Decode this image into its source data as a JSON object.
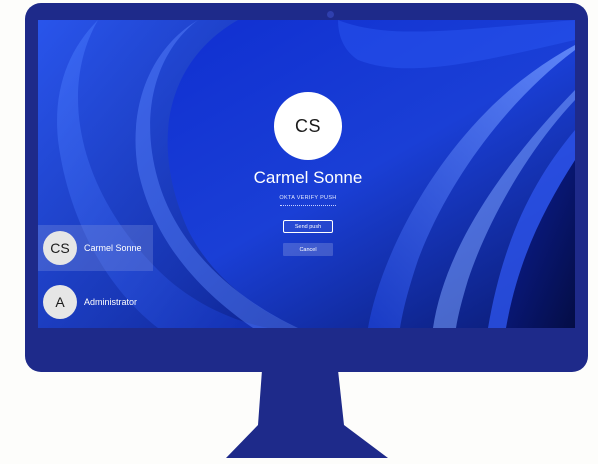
{
  "colors": {
    "frame": "#1e2a8a",
    "wallpaper": "#1636c6",
    "page_background": "#fdfdfb"
  },
  "login": {
    "avatar_initials": "CS",
    "user_name": "Carmel Sonne",
    "method_label": "OKTA VERIFY PUSH",
    "send_push_label": "Send push",
    "cancel_label": "Cancel"
  },
  "user_list": [
    {
      "initials": "CS",
      "name": "Carmel Sonne",
      "selected": true
    },
    {
      "initials": "A",
      "name": "Administrator",
      "selected": false
    }
  ]
}
